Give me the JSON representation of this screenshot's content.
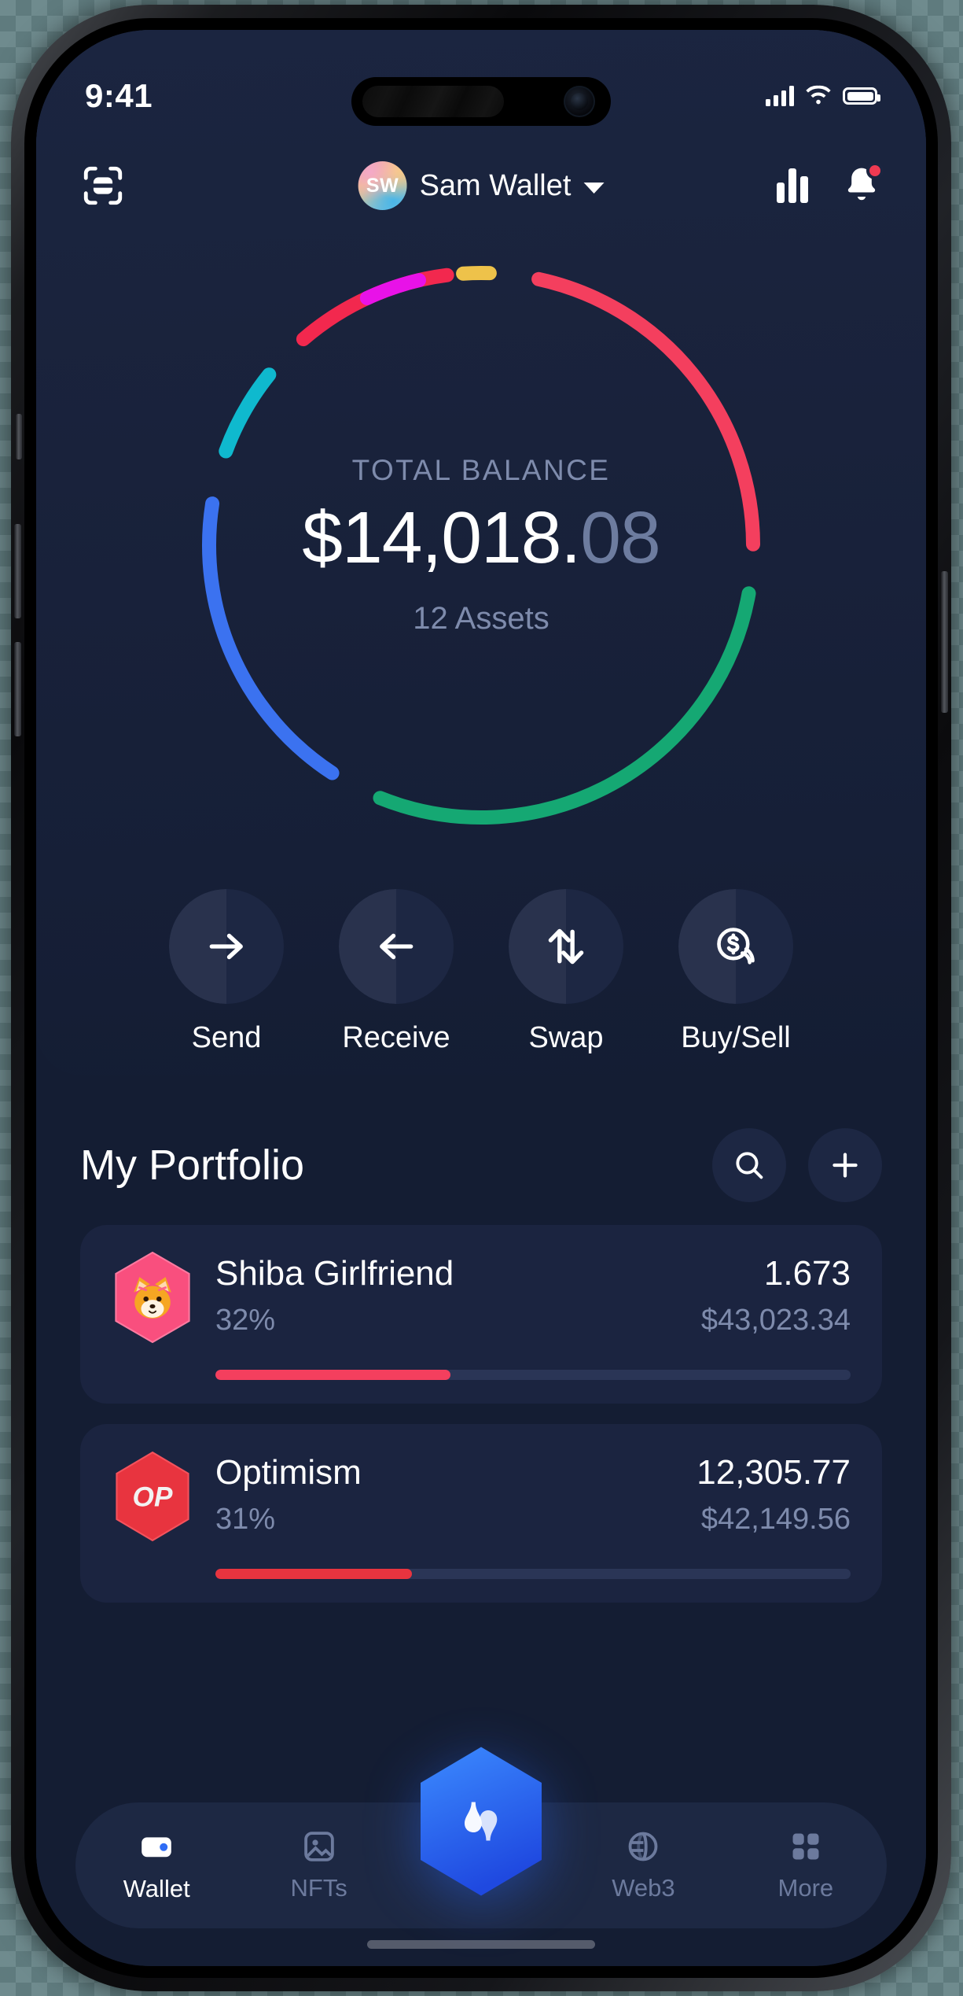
{
  "status_bar": {
    "time": "9:41",
    "signal_icon": "cellular-signal-icon",
    "wifi_icon": "wifi-icon",
    "battery_icon": "battery-full-icon"
  },
  "header": {
    "scan_icon": "qr-scan-icon",
    "avatar_initials": "SW",
    "wallet_name": "Sam Wallet",
    "chevron_icon": "chevron-down-icon",
    "chart_icon": "bar-chart-icon",
    "bell_icon": "bell-notification-icon",
    "has_unread": true,
    "notification_dot_color": "#ef3a52"
  },
  "balance": {
    "label": "TOTAL BALANCE",
    "amount_whole": "$14,018.",
    "amount_cents": "08",
    "assets_count_text": "12 Assets"
  },
  "actions": [
    {
      "label": "Send",
      "icon": "arrow-right-icon"
    },
    {
      "label": "Receive",
      "icon": "arrow-left-icon"
    },
    {
      "label": "Swap",
      "icon": "swap-vertical-arrows-icon"
    },
    {
      "label": "Buy/Sell",
      "icon": "dollar-coin-icon"
    }
  ],
  "portfolio": {
    "title": "My Portfolio",
    "search_icon": "search-icon",
    "add_icon": "plus-icon",
    "assets": [
      {
        "name": "Shiba Girlfriend",
        "percent": "32%",
        "quantity": "1.673",
        "fiat_value": "$43,023.34",
        "bar_fill_percent": 37,
        "bar_color": "#f43f5e",
        "logo": "shiba-girlfriend-logo",
        "logo_color": "#f94f7e"
      },
      {
        "name": "Optimism",
        "percent": "31%",
        "quantity": "12,305.77",
        "fiat_value": "$42,149.56",
        "bar_fill_percent": 31,
        "bar_color": "#e8343f",
        "logo": "optimism-logo",
        "logo_color": "#e8343f"
      }
    ]
  },
  "tabs": [
    {
      "label": "Wallet",
      "icon": "wallet-icon",
      "active": true
    },
    {
      "label": "NFTs",
      "icon": "image-frame-icon",
      "active": false
    },
    {
      "label": "Web3",
      "icon": "globe-icon",
      "active": false
    },
    {
      "label": "More",
      "icon": "grid-squares-icon",
      "active": false
    }
  ],
  "center_fab": {
    "icon": "infinity-wallet-hex-icon",
    "color": "#2f6df5"
  },
  "chart_data": {
    "type": "pie",
    "title": "Total Balance allocation",
    "total_label": "TOTAL BALANCE",
    "total_value": 14018.08,
    "assets_count": 12,
    "legend": false,
    "grid": false,
    "categories": [
      "Green asset",
      "Red/Pink asset",
      "Blue asset",
      "Cyan asset",
      "Crimson asset",
      "Magenta asset",
      "Yellow asset"
    ],
    "values": [
      30,
      24,
      20,
      7,
      11,
      5,
      3
    ],
    "colors": [
      "#15a873",
      "#f43f5e",
      "#3b72f0",
      "#0fb9ce",
      "#f2284e",
      "#e812e8",
      "#eec24a"
    ],
    "segments": [
      {
        "name": "Green asset",
        "value": 30,
        "color": "#15a873",
        "start_deg": 97,
        "sweep_deg": 108
      },
      {
        "name": "Red asset",
        "value": 24,
        "color": "#f43f5e",
        "start_deg": 9,
        "sweep_deg": 84
      },
      {
        "name": "Blue asset",
        "value": 20,
        "color": "#3b72f0",
        "start_deg": 210,
        "sweep_deg": 72
      },
      {
        "name": "Cyan asset",
        "value": 7,
        "color": "#0fb9ce",
        "start_deg": 287,
        "sweep_deg": 25
      },
      {
        "name": "Crimson asset",
        "value": 11,
        "color": "#f2284e",
        "start_deg": 316,
        "sweep_deg": 40
      },
      {
        "name": "Magenta asset",
        "value": 5,
        "color": "#e812e8",
        "start_deg": 332,
        "sweep_deg": 18
      },
      {
        "name": "Yellow asset",
        "value": 3,
        "color": "#eec24a",
        "start_deg": 353,
        "sweep_deg": 12
      }
    ]
  }
}
